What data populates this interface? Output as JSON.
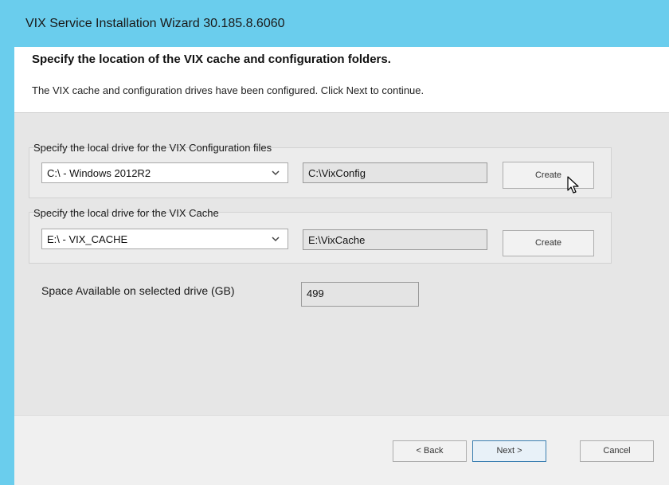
{
  "window": {
    "title": "VIX Service Installation Wizard 30.185.8.6060"
  },
  "header": {
    "title": "Specify the location of the VIX cache and configuration folders.",
    "subtitle": "The VIX cache and configuration drives have been configured. Click Next to continue."
  },
  "config_group": {
    "label": "Specify the local drive for the VIX Configuration files",
    "drive_selected": "C:\\ - Windows 2012R2",
    "folder_path": "C:\\VixConfig",
    "create_label": "Create"
  },
  "cache_group": {
    "label": "Specify the local drive for the VIX Cache",
    "drive_selected": "E:\\ - VIX_CACHE",
    "folder_path": "E:\\VixCache",
    "create_label": "Create"
  },
  "space": {
    "label": "Space Available on selected drive (GB)",
    "value": "499"
  },
  "footer": {
    "back_label": "< Back",
    "next_label": "Next >",
    "cancel_label": "Cancel"
  },
  "colors": {
    "titlebar": "#6acded",
    "next_border": "#3c7fb1"
  },
  "icons": {
    "combo_arrow": "chevron-down-icon",
    "cursor": "mouse-cursor-icon"
  }
}
